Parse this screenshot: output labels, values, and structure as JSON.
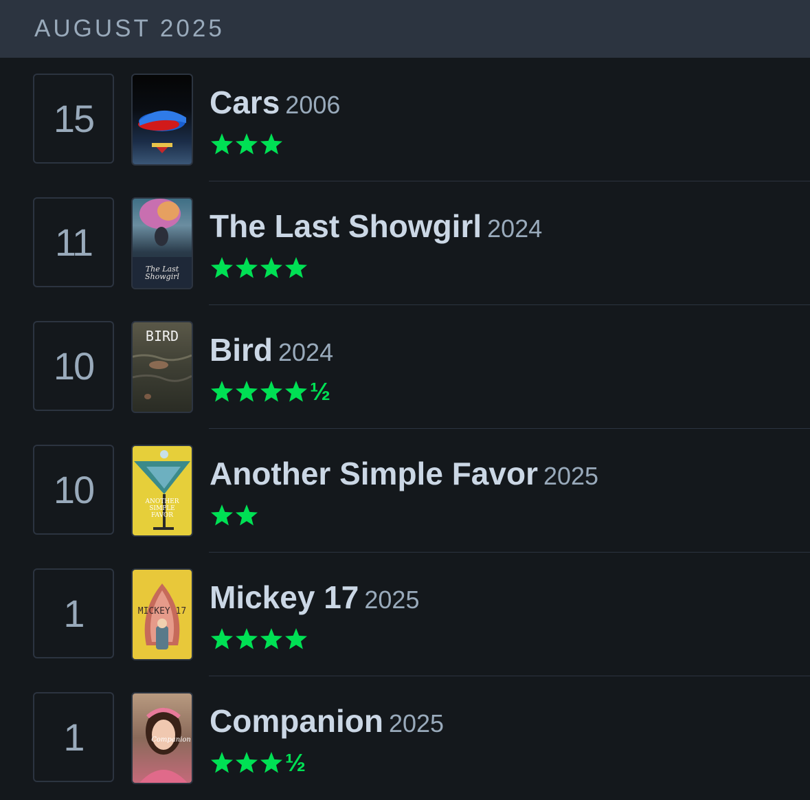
{
  "header": {
    "month": "AUGUST 2025"
  },
  "colors": {
    "star": "#00e054",
    "background": "#14181c",
    "header": "#2c3440"
  },
  "entries": [
    {
      "day": "15",
      "title": "Cars",
      "year": "2006",
      "rating": 3,
      "poster_icon": "cars-poster",
      "poster_text": ""
    },
    {
      "day": "11",
      "title": "The Last Showgirl",
      "year": "2024",
      "rating": 4,
      "poster_icon": "showgirl-poster",
      "poster_text": "The Last Showgirl"
    },
    {
      "day": "10",
      "title": "Bird",
      "year": "2024",
      "rating": 4.5,
      "poster_icon": "bird-poster",
      "poster_text": "BIRD"
    },
    {
      "day": "10",
      "title": "Another Simple Favor",
      "year": "2025",
      "rating": 2,
      "poster_icon": "simple-favor-poster",
      "poster_text": "ANOTHER SIMPLE FAVOR"
    },
    {
      "day": "1",
      "title": "Mickey 17",
      "year": "2025",
      "rating": 4,
      "poster_icon": "mickey17-poster",
      "poster_text": "MICKEY 17"
    },
    {
      "day": "1",
      "title": "Companion",
      "year": "2025",
      "rating": 3.5,
      "poster_icon": "companion-poster",
      "poster_text": "Companion"
    }
  ],
  "half_glyph": "½"
}
